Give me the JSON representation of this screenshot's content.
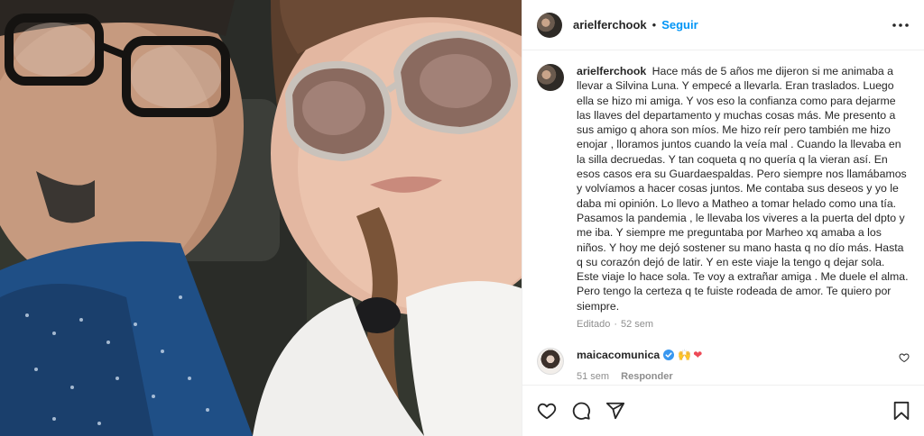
{
  "post": {
    "username": "arielferchook",
    "follow_label": "Seguir",
    "separator": "•"
  },
  "caption": {
    "username": "arielferchook",
    "text": "Hace más de 5 años me dijeron si me animaba a llevar a Silvina Luna. Y empecé a llevarla. Eran traslados. Luego ella se hizo mi amiga. Y vos eso la confianza como para dejarme las llaves del departamento y muchas cosas más. Me presento a sus amigo q ahora son míos. Me hizo reír pero también me hizo enojar , lloramos juntos cuando la veía mal . Cuando la llevaba en la silla decruedas. Y tan coqueta q no quería q la vieran así. En esos casos era su Guardaespaldas. Pero siempre nos llamábamos y volvíamos a hacer cosas juntos. Me contaba sus deseos y yo le daba mi opinión. Lo llevo a Matheo a tomar helado como una tía. Pasamos la pandemia , le llevaba los viveres a la puerta del dpto y me iba. Y siempre me preguntaba por Marheo xq amaba a los niños. Y hoy me dejó sostener su mano hasta q no dío más. Hasta q su corazón dejó de latir. Y en este viaje la tengo q dejar sola. Este viaje lo hace sola. Te voy a extrañar amiga . Me duele el alma. Pero tengo la certeza q te fuiste rodeada de amor. Te quiero por siempre.",
    "edited_label": "Editado",
    "meta_separator": "·",
    "time": "52 sem"
  },
  "comment": {
    "username": "maicacomunica",
    "emojis": "🙌",
    "heart_emoji": "❤",
    "time": "51 sem",
    "reply_label": "Responder"
  },
  "icons": {
    "more": "more-horizontal-icon",
    "like": "heart-outline-icon",
    "comment": "comment-bubble-icon",
    "share": "paper-plane-icon",
    "save": "bookmark-icon",
    "verified": "verified-badge-icon"
  },
  "colors": {
    "link_blue": "#0095f6",
    "text": "#262626",
    "secondary_text": "#8e8e8e",
    "verified_blue": "#3897f0",
    "heart_red": "#ed4956"
  }
}
